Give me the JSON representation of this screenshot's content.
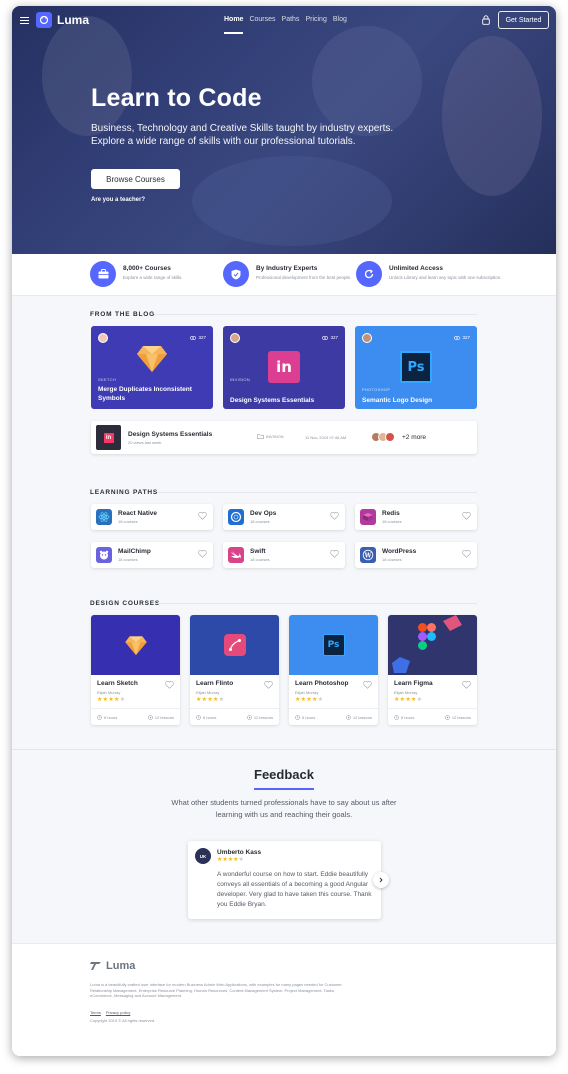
{
  "nav": {
    "brand": "Luma",
    "links": [
      "Home",
      "Courses",
      "Paths",
      "Pricing",
      "Blog"
    ],
    "active": "Home",
    "cta": "Get Started"
  },
  "hero": {
    "title": "Learn to Code",
    "subtitle": "Business, Technology and Creative Skills taught by industry experts. Explore a wide range of skills with our professional tutorials.",
    "button": "Browse Courses",
    "teacher_link": "Are you a teacher?"
  },
  "features": [
    {
      "title": "8,000+ Courses",
      "desc": "Explore a wide range of skills.",
      "icon": "briefcase-icon"
    },
    {
      "title": "By Industry Experts",
      "desc": "Professional development from the best people.",
      "icon": "shield-check-icon"
    },
    {
      "title": "Unlimited Access",
      "desc": "Unlock Library and learn any topic with one subscription.",
      "icon": "refresh-icon"
    }
  ],
  "blog": {
    "section_title": "FROM THE BLOG",
    "cards": [
      {
        "category": "SKETCH",
        "title": "Merge Duplicates Inconsistent Symbols",
        "views": "327",
        "color": "#3e3bb5"
      },
      {
        "category": "INVISION",
        "title": "Design Systems Essentials",
        "views": "327",
        "color": "#3d3aa3"
      },
      {
        "category": "PHOTOSHOP",
        "title": "Semantic Logo Design",
        "views": "327",
        "color": "#3d8cf0"
      }
    ],
    "row": {
      "title": "Design Systems Essentials",
      "sub": "20 views last week",
      "category": "INVISION",
      "date": "11 Nov, 2019 07:46 AM",
      "more": "+2 more"
    }
  },
  "paths": {
    "section_title": "LEARNING PATHS",
    "items": [
      {
        "name": "React Native",
        "count": "18 courses",
        "color": "#3aa6e8"
      },
      {
        "name": "Dev Ops",
        "count": "18 courses",
        "color": "#1f6fd1"
      },
      {
        "name": "Redis",
        "count": "18 courses",
        "color": "#b03b9a"
      },
      {
        "name": "MailChimp",
        "count": "18 courses",
        "color": "#6a63e0"
      },
      {
        "name": "Swift",
        "count": "18 courses",
        "color": "#d9438a"
      },
      {
        "name": "WordPress",
        "count": "18 courses",
        "color": "#3c5eb0"
      }
    ]
  },
  "courses": {
    "section_title": "DESIGN COURSES",
    "items": [
      {
        "name": "Learn Sketch",
        "author": "Elijah Murray",
        "rating": 4,
        "hours": "6 hours",
        "lessons": "12 lessons",
        "color": "#3630b0"
      },
      {
        "name": "Learn Flinto",
        "author": "Elijah Murray",
        "rating": 4,
        "hours": "6 hours",
        "lessons": "12 lessons",
        "color": "#2d4aa8"
      },
      {
        "name": "Learn Photoshop",
        "author": "Elijah Murray",
        "rating": 4,
        "hours": "6 hours",
        "lessons": "12 lessons",
        "color": "#3d8cf0"
      },
      {
        "name": "Learn Figma",
        "author": "Elijah Murray",
        "rating": 4,
        "hours": "6 hours",
        "lessons": "12 lessons",
        "color": "#30356e"
      }
    ]
  },
  "feedback": {
    "title": "Feedback",
    "subtitle": "What other students turned professionals have to say about us after learning with us and reaching their goals.",
    "testimonial": {
      "initials": "UK",
      "name": "Umberto Kass",
      "rating": 4,
      "quote": "A wonderful course on how to start. Eddie beautifully conveys all essentials of a becoming a good Angular developer. Very glad to have taken this course. Thank you Eddie Bryan."
    }
  },
  "footer": {
    "brand": "Luma",
    "description": "Luma is a beautifully crafted user interface for modern Business Admin Web Applications, with examples for many pages needed for Customer Relationship Management, Enterprise Resource Planning, Human Resources, Content Management System, Project Management, Tasks, eCommerce, Messaging and Account Management.",
    "links": [
      "Terms",
      "Privacy policy"
    ],
    "copyright": "Copyright 2019 © All rights reserved."
  },
  "colors": {
    "accent": "#5567ff",
    "star": "#f9b90b"
  }
}
